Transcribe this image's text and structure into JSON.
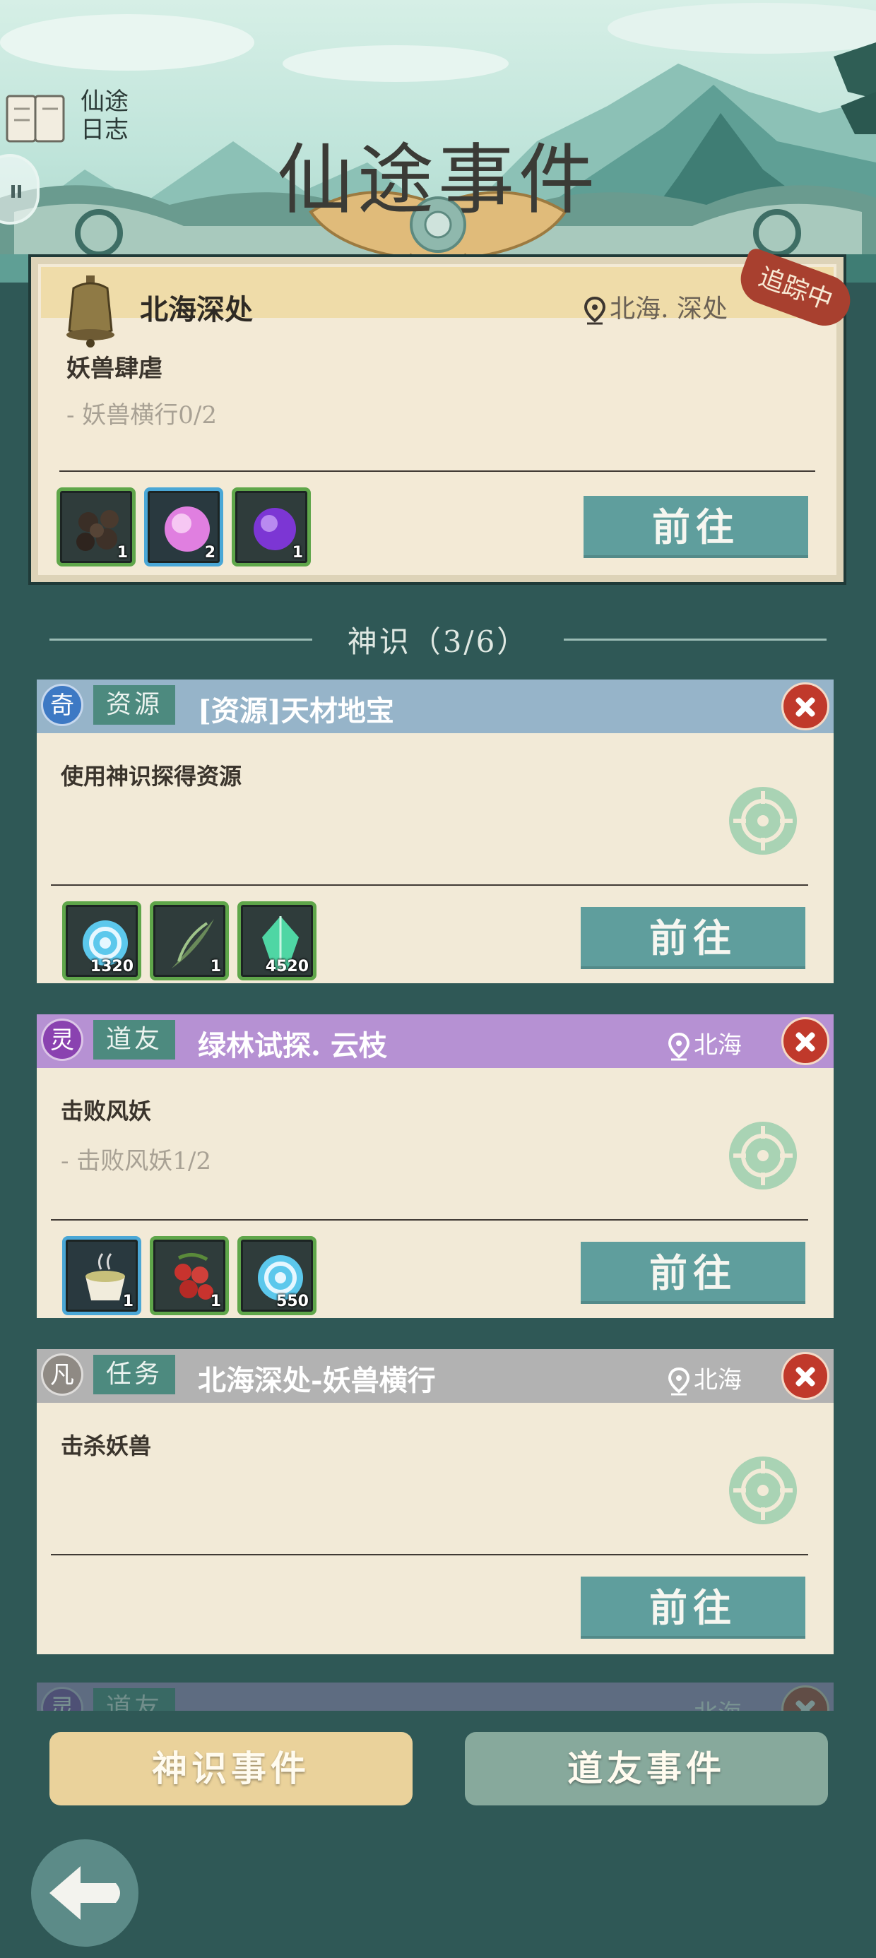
{
  "header": {
    "title": "仙途事件",
    "journal_label": "仙途日志"
  },
  "tracked": {
    "name": "北海深处",
    "location": "北海. 深处",
    "badge": "追踪中",
    "objective": "妖兽肆虐",
    "progress": "- 妖兽横行0/2",
    "rewards": [
      {
        "icon": "black-pills-icon",
        "count": "1"
      },
      {
        "icon": "pink-orb-icon",
        "count": "2"
      },
      {
        "icon": "purple-orb-icon",
        "count": "1"
      }
    ],
    "go_label": "前往"
  },
  "section": {
    "label": "神识（3/6）"
  },
  "events": [
    {
      "grade": "奇",
      "grade_color": "#3d79c4",
      "bar_color": "#96b4c9",
      "kind": "资源",
      "title": "[资源]天材地宝",
      "location": "",
      "objective": "使用神识探得资源",
      "progress": "",
      "rewards": [
        {
          "icon": "blue-swirl-icon",
          "count": "1320"
        },
        {
          "icon": "herb-leaf-icon",
          "count": "1"
        },
        {
          "icon": "green-crystal-icon",
          "count": "4520"
        }
      ],
      "go_label": "前往"
    },
    {
      "grade": "灵",
      "grade_color": "#8a42b0",
      "bar_color": "#b691d3",
      "kind": "道友",
      "title": "绿林试探. 云枝",
      "location": "北海",
      "objective": "击败风妖",
      "progress": "- 击败风妖1/2",
      "rewards": [
        {
          "icon": "tea-cup-icon",
          "count": "1"
        },
        {
          "icon": "red-berries-icon",
          "count": "1"
        },
        {
          "icon": "blue-swirl-icon",
          "count": "550"
        }
      ],
      "go_label": "前往"
    },
    {
      "grade": "凡",
      "grade_color": "#8f8a84",
      "bar_color": "#b2b2b2",
      "kind": "任务",
      "title": "北海深处-妖兽横行",
      "location": "北海",
      "objective": "击杀妖兽",
      "progress": "",
      "rewards": [],
      "go_label": "前往"
    },
    {
      "grade": "灵",
      "grade_color": "#8a42b0",
      "bar_color": "#7e5a92",
      "kind": "道友",
      "title": "",
      "location": "北海"
    }
  ],
  "bottom": {
    "tab_active": "神识事件",
    "tab_inactive": "道友事件"
  }
}
